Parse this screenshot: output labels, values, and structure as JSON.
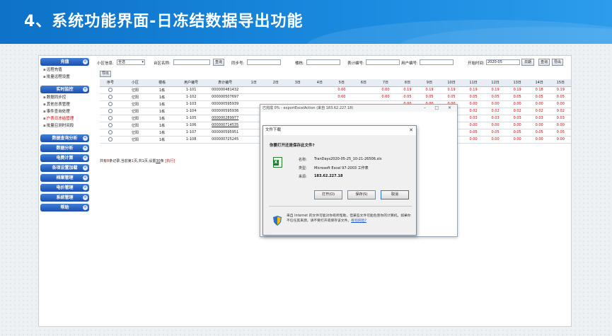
{
  "slide": {
    "title": "4、系统功能界面-日冻结数据导出功能"
  },
  "sidebar": {
    "sections": [
      {
        "label": "充值",
        "items": [
          "远程充值",
          "批量远程设置"
        ]
      },
      {
        "label": "实时监控",
        "items": [
          "数据同步控",
          "其他总表管理",
          "事件查询处理",
          "户表日冻结管理",
          "批量召测时间段"
        ],
        "highlight_index": 3
      },
      {
        "label": "数据查询分析",
        "items": []
      },
      {
        "label": "数据分析",
        "items": []
      },
      {
        "label": "电费计算",
        "items": []
      },
      {
        "label": "各项设置加载",
        "items": []
      },
      {
        "label": "档案管理",
        "items": []
      },
      {
        "label": "电价管理",
        "items": []
      },
      {
        "label": "系统管理",
        "items": []
      },
      {
        "label": "帮助",
        "items": []
      }
    ]
  },
  "toolbar": {
    "area_label": "小区信息:",
    "area_value": "全选",
    "platform_label": "台区名称:",
    "query_label": "查询",
    "sync_label": "同步号:",
    "building_label": "楼栋:",
    "meter_label": "表计编号:",
    "user_label": "用户编号:",
    "start_label": "开始时间:",
    "start_value": "2020-05",
    "day_label": "日期",
    "search_label": "查询",
    "export_label": "导出"
  },
  "export_button": "导出",
  "table": {
    "headers": [
      "序号",
      "小区",
      "楼栋",
      "用户编号",
      "表计编号",
      "1日",
      "2日",
      "3日",
      "4日",
      "5日",
      "6日",
      "7日",
      "8日",
      "9日",
      "10日",
      "11日",
      "12日",
      "13日",
      "14日",
      "15日"
    ],
    "rows": [
      [
        "亿阳",
        "1栋",
        "1-101",
        "000000481432",
        "",
        "",
        "",
        "",
        "0.00",
        "",
        "0.00",
        "0.19",
        "0.19",
        "0.19",
        "0.19",
        "0.19",
        "0.19",
        "0.18",
        "0.19"
      ],
      [
        "亿阳",
        "1栋",
        "1-102",
        "000000507697",
        "",
        "",
        "",
        "",
        "0.00",
        "",
        "0.00",
        "0.05",
        "0.05",
        "0.05",
        "0.05",
        "0.05",
        "0.05",
        "0.05",
        "0.05"
      ],
      [
        "亿阳",
        "1栋",
        "1-103",
        "000000595939",
        "",
        "",
        "",
        "",
        "",
        "",
        "",
        "0.00",
        "0.00",
        "0.00",
        "0.00",
        "0.00",
        "0.00",
        "0.00",
        "0.00"
      ],
      [
        "亿阳",
        "1栋",
        "1-104",
        "000000595936",
        "",
        "",
        "",
        "",
        "",
        "",
        "",
        "0.02",
        "0.02",
        "0.02",
        "0.02",
        "0.02",
        "0.02",
        "0.02",
        "0.02"
      ],
      [
        "亿阳",
        "1栋",
        "1-105",
        "000000289977",
        "",
        "",
        "",
        "",
        "",
        "",
        "",
        "0.03",
        "0.03",
        "0.03",
        "0.03",
        "0.03",
        "0.03",
        "0.03",
        "0.03"
      ],
      [
        "亿阳",
        "1栋",
        "1-106",
        "000000714535",
        "",
        "",
        "",
        "",
        "",
        "",
        "",
        "0.00",
        "0.00",
        "0.00",
        "0.00",
        "0.00",
        "0.00",
        "0.00",
        "0.00"
      ],
      [
        "亿阳",
        "1栋",
        "1-107",
        "000000595951",
        "",
        "",
        "",
        "",
        "",
        "",
        "",
        "0.05",
        "0.05",
        "0.05",
        "0.05",
        "0.05",
        "0.05",
        "0.05",
        "0.05"
      ],
      [
        "亿阳",
        "1栋",
        "1-108",
        "000000725245",
        "",
        "",
        "",
        "",
        "",
        "",
        "",
        "0.00",
        "0.00",
        "0.00",
        "0.00",
        "0.00",
        "0.00",
        "0.00",
        "0.00"
      ]
    ]
  },
  "pager": {
    "prefix": "共有",
    "count": "8",
    "mid": "条记录,当前第",
    "page": "1",
    "total_text": "页,共1页,设置",
    "size": "30",
    "suffix": "条",
    "exec": "[执行]"
  },
  "download_window": {
    "title": "已完成 0% - exportExcelAction (来自 183.62.227.18)",
    "minimize": "–",
    "maximize": "□",
    "close": "✕"
  },
  "dialog": {
    "title": "文件下载",
    "close": "✕",
    "question": "你要打开还是保存此文件?",
    "name_label": "名称:",
    "name_value": "TranDays2020-05-25_10-21-26506.xls",
    "type_label": "类型:",
    "type_value": "Microsoft Excel 97-2003 工作表",
    "source_label": "来源:",
    "source_value": "183.62.227.18",
    "open_label": "打开(O)",
    "save_label": "保存(S)",
    "cancel_label": "取消",
    "warning_text": "来自 Internet 的文件可能对你有所帮助，但某些文件可能危害你的计算机。如果你不信任其来源，请不要打开或保存该文件。",
    "risk_link": "有何风险?"
  }
}
